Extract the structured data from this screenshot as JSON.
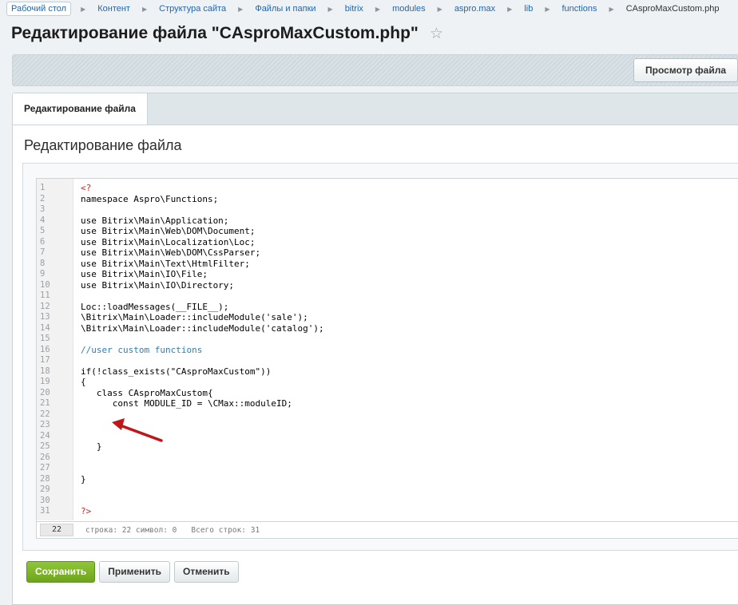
{
  "breadcrumb": {
    "items": [
      "Рабочий стол",
      "Контент",
      "Структура сайта",
      "Файлы и папки",
      "bitrix",
      "modules",
      "aspro.max",
      "lib",
      "functions",
      "CAsproMaxCustom.php"
    ]
  },
  "page_title": "Редактирование файла \"CAsproMaxCustom.php\"",
  "toolbar": {
    "preview_button": "Просмотр файла"
  },
  "tabs": [
    {
      "label": "Редактирование файла"
    }
  ],
  "section_title": "Редактирование файла",
  "editor": {
    "lines": [
      "<?",
      "namespace Aspro\\Functions;",
      "",
      "use Bitrix\\Main\\Application;",
      "use Bitrix\\Main\\Web\\DOM\\Document;",
      "use Bitrix\\Main\\Localization\\Loc;",
      "use Bitrix\\Main\\Web\\DOM\\CssParser;",
      "use Bitrix\\Main\\Text\\HtmlFilter;",
      "use Bitrix\\Main\\IO\\File;",
      "use Bitrix\\Main\\IO\\Directory;",
      "",
      "Loc::loadMessages(__FILE__);",
      "\\Bitrix\\Main\\Loader::includeModule('sale');",
      "\\Bitrix\\Main\\Loader::includeModule('catalog');",
      "",
      "//user custom functions",
      "",
      "if(!class_exists(\"CAsproMaxCustom\"))",
      "{",
      "   class CAsproMaxCustom{",
      "      const MODULE_ID = \\CMax::moduleID;",
      "",
      "",
      "",
      "   }",
      "",
      "",
      "}",
      "",
      "",
      "?>"
    ],
    "status": {
      "current_line": "22",
      "position": "строка: 22  символ: 0",
      "total": "Всего строк: 31"
    }
  },
  "buttons": {
    "save": "Сохранить",
    "apply": "Применить",
    "cancel": "Отменить"
  },
  "colors": {
    "save": "#7ab52a",
    "link": "#2067b0",
    "annotation_arrow": "#c0161a"
  }
}
